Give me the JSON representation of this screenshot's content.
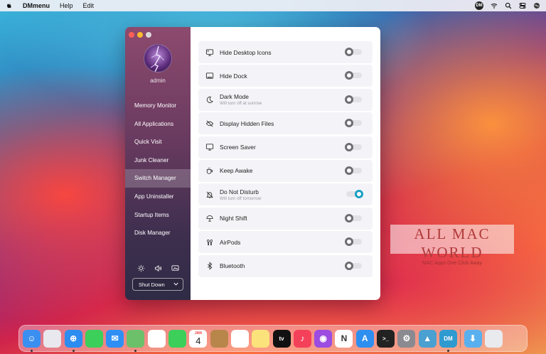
{
  "menubar": {
    "app_name": "DMmenu",
    "items": [
      "Help",
      "Edit"
    ],
    "dm_badge": "DM",
    "icons": [
      "apple-icon",
      "dm-status-icon",
      "wifi-icon",
      "search-icon",
      "control-center-icon",
      "siri-icon"
    ]
  },
  "sidebar": {
    "username": "admin",
    "items": [
      {
        "label": "Memory Monitor",
        "active": false
      },
      {
        "label": "All Applications",
        "active": false
      },
      {
        "label": "Quick Visit",
        "active": false
      },
      {
        "label": "Junk Cleaner",
        "active": false
      },
      {
        "label": "Switch Manager",
        "active": true
      },
      {
        "label": "App Uninstaller",
        "active": false
      },
      {
        "label": "Startup Items",
        "active": false
      },
      {
        "label": "Disk Manager",
        "active": false
      }
    ],
    "tools": [
      "brightness-icon",
      "volume-icon",
      "display-icon"
    ],
    "shutdown_label": "Shut Down"
  },
  "switches": [
    {
      "label": "Hide Desktop Icons",
      "subtitle": "",
      "on": false,
      "icon": "desktop-icon"
    },
    {
      "label": "Hide Dock",
      "subtitle": "",
      "on": false,
      "icon": "dock-icon"
    },
    {
      "label": "Dark Mode",
      "subtitle": "Will turn off at sunrise",
      "on": false,
      "icon": "moon-icon"
    },
    {
      "label": "Display Hidden Files",
      "subtitle": "",
      "on": false,
      "icon": "eye-slash-icon"
    },
    {
      "label": "Screen Saver",
      "subtitle": "",
      "on": false,
      "icon": "monitor-icon"
    },
    {
      "label": "Keep Awake",
      "subtitle": "",
      "on": false,
      "icon": "coffee-icon"
    },
    {
      "label": "Do Not Disturb",
      "subtitle": "Will turn off tomorrow",
      "on": true,
      "icon": "bell-slash-icon"
    },
    {
      "label": "Night Shift",
      "subtitle": "",
      "on": false,
      "icon": "night-shift-icon"
    },
    {
      "label": "AirPods",
      "subtitle": "",
      "on": false,
      "icon": "airpods-icon"
    },
    {
      "label": "Bluetooth",
      "subtitle": "",
      "on": false,
      "icon": "bluetooth-icon"
    }
  ],
  "watermark": {
    "title": "ALL MAC WORLD",
    "subtitle": "MAC Apps One Click Away"
  },
  "dock": {
    "apps": [
      {
        "name": "finder",
        "color": "#3a8ff0",
        "glyph": "☺",
        "running": true
      },
      {
        "name": "launchpad",
        "color": "#e8e8ee",
        "glyph": "",
        "running": false
      },
      {
        "name": "safari",
        "color": "#2d8cf0",
        "glyph": "⊕",
        "running": true
      },
      {
        "name": "messages",
        "color": "#3ccf5a",
        "glyph": "",
        "running": false
      },
      {
        "name": "mail",
        "color": "#2f8ff5",
        "glyph": "✉",
        "running": false
      },
      {
        "name": "maps",
        "color": "#6cc06a",
        "glyph": "",
        "running": true
      },
      {
        "name": "photos",
        "color": "#ffffff",
        "glyph": "",
        "running": false
      },
      {
        "name": "facetime",
        "color": "#3ccf5a",
        "glyph": "",
        "running": false
      },
      {
        "name": "calendar",
        "color": "#ffffff",
        "glyph": "4",
        "running": false
      },
      {
        "name": "contacts",
        "color": "#b8864a",
        "glyph": "",
        "running": false
      },
      {
        "name": "reminders",
        "color": "#ffffff",
        "glyph": "",
        "running": false
      },
      {
        "name": "notes",
        "color": "#fbe27a",
        "glyph": "",
        "running": false
      },
      {
        "name": "tv",
        "color": "#111111",
        "glyph": "tv",
        "running": false
      },
      {
        "name": "music",
        "color": "#f5405a",
        "glyph": "♪",
        "running": false
      },
      {
        "name": "podcasts",
        "color": "#9c4ce0",
        "glyph": "◉",
        "running": false
      },
      {
        "name": "news",
        "color": "#ffffff",
        "glyph": "N",
        "running": false
      },
      {
        "name": "app-store",
        "color": "#2e8ff0",
        "glyph": "A",
        "running": false
      },
      {
        "name": "terminal",
        "color": "#222222",
        "glyph": ">_",
        "running": false
      },
      {
        "name": "system-preferences",
        "color": "#8a8a90",
        "glyph": "⚙",
        "running": false
      },
      {
        "name": "big-sur-installer",
        "color": "#4aa0d0",
        "glyph": "▲",
        "running": false
      },
      {
        "name": "dmmenu",
        "color": "#2f9ad0",
        "glyph": "DM",
        "running": true
      }
    ],
    "trailing": [
      {
        "name": "downloads-folder",
        "color": "#5ab0ee",
        "glyph": "⬇"
      },
      {
        "name": "trash",
        "color": "#e8eaee",
        "glyph": ""
      }
    ],
    "calendar_month": "JAN"
  }
}
